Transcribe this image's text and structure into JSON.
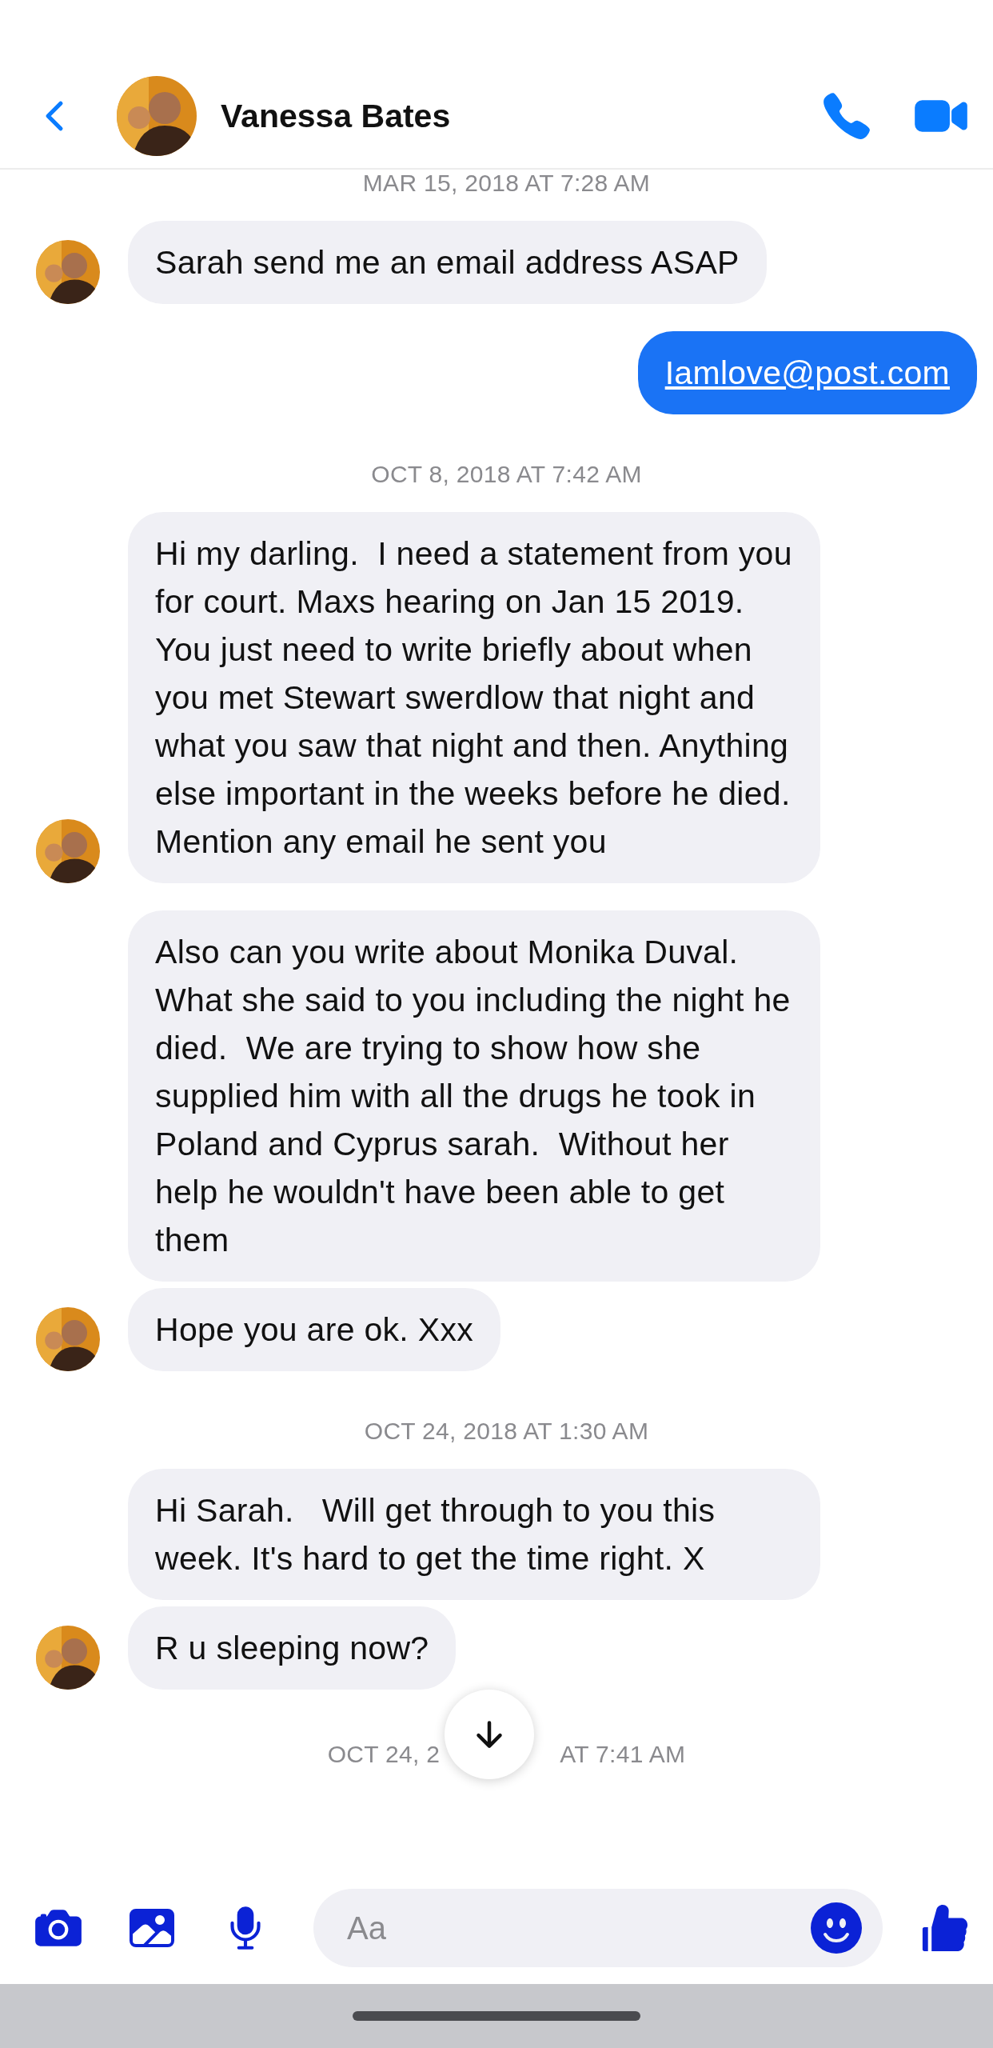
{
  "header": {
    "contact_name": "Vanessa Bates"
  },
  "messages": [
    {
      "kind": "timestamp",
      "text": "MAR 15, 2018 AT 7:28 AM"
    },
    {
      "kind": "incoming",
      "text": "Sarah send me an email address ASAP",
      "show_avatar": true
    },
    {
      "kind": "outgoing",
      "text": "Iamlove@post.com",
      "link": true
    },
    {
      "kind": "timestamp",
      "text": "OCT 8, 2018 AT 7:42 AM"
    },
    {
      "kind": "incoming",
      "text": "Hi my darling.  I need a statement from you for court. Maxs hearing on Jan 15 2019. You just need to write briefly about when you met Stewart swerdlow that night and what you saw that night and then. Anything else important in the weeks before he died. Mention any email he sent you",
      "show_avatar": true
    },
    {
      "kind": "incoming",
      "text": "Also can you write about Monika Duval. What she said to you including the night he died.  We are trying to show how she supplied him with all the drugs he took in Poland and Cyprus sarah.  Without her help he wouldn't have been able to get them",
      "show_avatar": false
    },
    {
      "kind": "incoming",
      "text": "Hope you are ok. Xxx",
      "show_avatar": true
    },
    {
      "kind": "timestamp",
      "text": "OCT 24, 2018 AT 1:30 AM"
    },
    {
      "kind": "incoming",
      "text": "Hi Sarah.   Will get through to you this week. It's hard to get the time right. X",
      "show_avatar": false
    },
    {
      "kind": "incoming",
      "text": "R u sleeping now?",
      "show_avatar": true
    },
    {
      "kind": "timestamp_split",
      "parts": [
        "OCT 24, 2",
        "AT 7:41 AM"
      ]
    }
  ],
  "composer": {
    "placeholder": "Aa"
  }
}
